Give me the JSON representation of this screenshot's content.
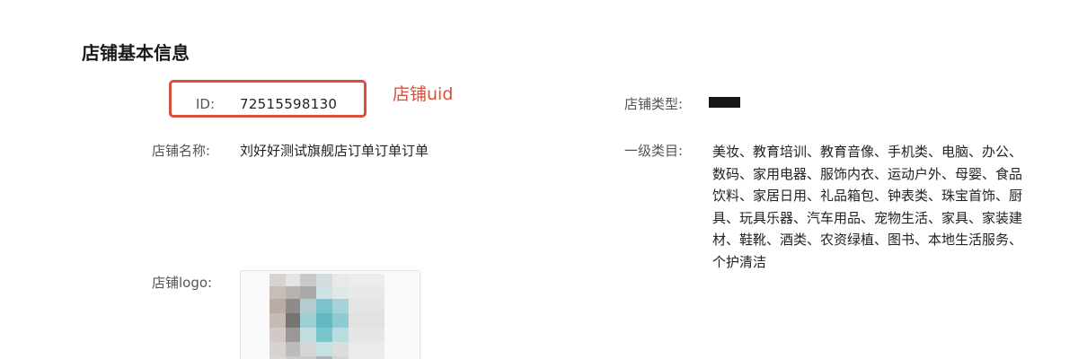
{
  "section": {
    "title": "店铺基本信息"
  },
  "fields": {
    "id": {
      "label": "ID:",
      "value": "72515598130"
    },
    "store_name": {
      "label": "店铺名称:",
      "value": "刘好好测试旗舰店订单订单订单"
    },
    "store_logo": {
      "label": "店铺logo:"
    },
    "store_type": {
      "label": "店铺类型:"
    },
    "primary_category": {
      "label": "一级类目:",
      "value": "美妆、教育培训、教育音像、手机类、电脑、办公、数码、家用电器、服饰内衣、运动户外、母婴、食品饮料、家居日用、礼品箱包、钟表类、珠宝首饰、厨具、玩具乐器、汽车用品、宠物生活、家具、家装建材、鞋靴、酒类、农资绿植、图书、本地生活服务、个护清洁"
    }
  },
  "annotation": {
    "text": "店铺uid",
    "color": "#d9503a"
  }
}
